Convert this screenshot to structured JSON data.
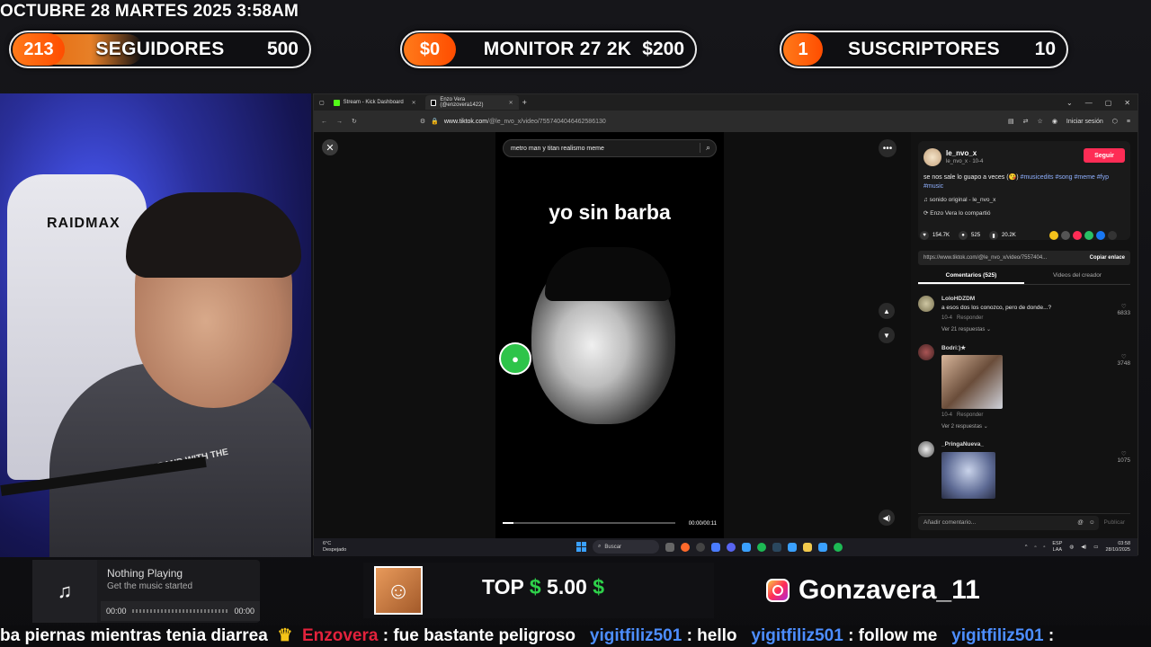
{
  "overlay": {
    "date": "OCTUBRE 28 MARTES 2025 3:58AM",
    "goals": [
      {
        "current": "213",
        "label": "SEGUIDORES",
        "target": "500",
        "progress": 0.43
      },
      {
        "current": "$0",
        "label": "MONITOR 27 2K",
        "target": "$200",
        "progress": 0.0
      },
      {
        "current": "1",
        "label": "SUSCRIPTORES",
        "target": "10",
        "progress": 0.1
      }
    ],
    "chair_brand": "RAIDMAX",
    "hoodie_text": "THE BRAND WITH THE"
  },
  "browser": {
    "tabs": [
      {
        "title": "Stream - Kick Dashboard",
        "icon": "kick-icon"
      },
      {
        "title": "Enzo Vera (@enzovera1422)",
        "icon": "tiktok-icon"
      }
    ],
    "url_host": "www.tiktok.com",
    "url_path": "/@le_nvo_x/video/7557404046462586130",
    "signin": "Iniciar sesión"
  },
  "tiktok": {
    "search_value": "metro man y titan realismo meme",
    "caption": "yo sin barba",
    "video_progress": 0.06,
    "time": "00:00/00:11",
    "author": {
      "name": "le_nvo_x",
      "sub": "le_nvo_x · 10-4",
      "follow": "Seguir",
      "desc": "se nos sale lo guapo a veces (😘)",
      "tags": "#musicedits #song #meme #fyp #music",
      "sound": "♫  sonido original - le_nvo_x",
      "shared": "Enzo Vera lo compartió"
    },
    "stats": {
      "likes": "154.7K",
      "comments": "525",
      "saves": "20.2K"
    },
    "link": "https://www.tiktok.com/@le_nvo_x/video/7557404...",
    "copy_link": "Copiar enlace",
    "comment_tabs": [
      "Comentarios (525)",
      "Videos del creador"
    ],
    "comments": [
      {
        "user": "LoloHDZDM",
        "text": "a esos dos los conozco, pero de donde...?",
        "date": "10-4",
        "reply": "Responder",
        "replies": "Ver 21 respuestas",
        "likes": "6833"
      },
      {
        "user": "Bodri:)★",
        "text": "",
        "date": "10-4",
        "reply": "Responder",
        "replies": "Ver 2 respuestas",
        "likes": "3748"
      },
      {
        "user": "_PringaNueva_",
        "text": "",
        "date": "",
        "reply": "",
        "replies": "",
        "likes": "1075"
      }
    ],
    "add_comment": "Añadir comentario...",
    "publish": "Publicar"
  },
  "taskbar": {
    "weather_temp": "6°C",
    "weather_desc": "Despejado",
    "search": "Buscar",
    "lang": "ESP",
    "lang2": "LAA",
    "time": "03:58",
    "date": "28/10/2025"
  },
  "music": {
    "title": "Nothing Playing",
    "subtitle": "Get the music started",
    "start": "00:00",
    "end": "00:00"
  },
  "donor": {
    "label": "TOP",
    "amount": "5.00"
  },
  "instagram": {
    "handle": "Gonzavera_11"
  },
  "chat": {
    "prefix": "ba piernas mientras tenia diarrea",
    "messages": [
      {
        "user": "Enzovera",
        "text": ": fue bastante peligroso"
      },
      {
        "user": "yigitfiliz501",
        "text": ": hello"
      },
      {
        "user": "yigitfiliz501",
        "text": ": follow me"
      },
      {
        "user": "yigitfiliz501",
        "text": ":"
      }
    ]
  },
  "colors": {
    "accent_orange": "#ff6a00",
    "tiktok_red": "#fe2c55",
    "money_green": "#2ed14a",
    "chat_red": "#e3223c",
    "chat_blue": "#4d8eff"
  }
}
